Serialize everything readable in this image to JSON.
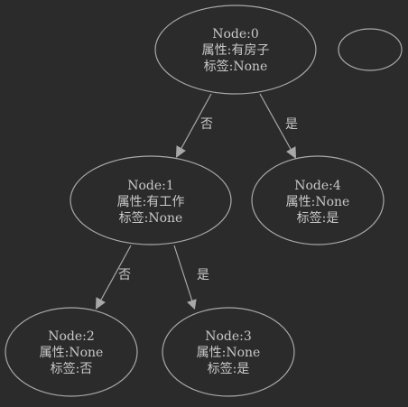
{
  "graph": {
    "nodes": [
      {
        "id": "0",
        "title": "Node:0",
        "attribute": "属性:有房子",
        "label": "标签:None"
      },
      {
        "id": "1",
        "title": "Node:1",
        "attribute": "属性:有工作",
        "label": "标签:None"
      },
      {
        "id": "2",
        "title": "Node:2",
        "attribute": "属性:None",
        "label": "标签:否"
      },
      {
        "id": "3",
        "title": "Node:3",
        "attribute": "属性:None",
        "label": "标签:是"
      },
      {
        "id": "4",
        "title": "Node:4",
        "attribute": "属性:None",
        "label": "标签:是"
      },
      {
        "id": "empty"
      }
    ],
    "edges": [
      {
        "from": "0",
        "to": "1",
        "label": "否"
      },
      {
        "from": "0",
        "to": "4",
        "label": "是"
      },
      {
        "from": "1",
        "to": "2",
        "label": "否"
      },
      {
        "from": "1",
        "to": "3",
        "label": "是"
      }
    ],
    "colors": {
      "background": "#2b2b2b",
      "stroke": "#a8a8a8",
      "text": "#c8c8c8"
    }
  }
}
